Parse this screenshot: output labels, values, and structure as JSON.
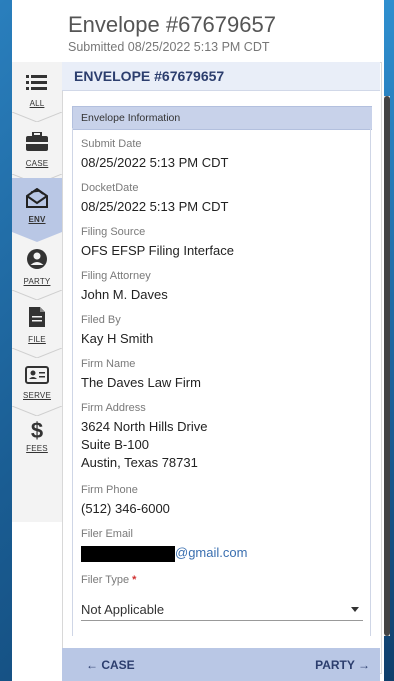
{
  "header": {
    "title": "Envelope #67679657",
    "subtitle": "Submitted 08/25/2022 5:13 PM CDT"
  },
  "sidebar": {
    "items": [
      {
        "label": "ALL",
        "icon": "list-icon"
      },
      {
        "label": "CASE",
        "icon": "briefcase-icon"
      },
      {
        "label": "ENV",
        "icon": "envelope-icon",
        "active": true
      },
      {
        "label": "PARTY",
        "icon": "person-icon"
      },
      {
        "label": "FILE",
        "icon": "document-icon"
      },
      {
        "label": "SERVE",
        "icon": "id-card-icon"
      },
      {
        "label": "FEES",
        "icon": "dollar-icon"
      }
    ]
  },
  "panel": {
    "title": "ENVELOPE #67679657",
    "section_title": "Envelope Information",
    "fields": {
      "submit_date_label": "Submit Date",
      "submit_date": "08/25/2022 5:13 PM CDT",
      "docket_date_label": "DocketDate",
      "docket_date": "08/25/2022 5:13 PM CDT",
      "filing_source_label": "Filing Source",
      "filing_source": "OFS EFSP Filing Interface",
      "filing_attorney_label": "Filing Attorney",
      "filing_attorney": "John M. Daves",
      "filed_by_label": "Filed By",
      "filed_by": "Kay H Smith",
      "firm_name_label": "Firm Name",
      "firm_name": "The Daves Law Firm",
      "firm_address_label": "Firm Address",
      "firm_address_line1": "3624 North Hills Drive",
      "firm_address_line2": "Suite B-100",
      "firm_address_line3": "Austin, Texas 78731",
      "firm_phone_label": "Firm Phone",
      "firm_phone": "(512) 346-6000",
      "filer_email_label": "Filer Email",
      "filer_email_domain": "@gmail.com",
      "filer_type_label": "Filer Type",
      "filer_type_required": "*",
      "filer_type": "Not Applicable"
    }
  },
  "footer": {
    "prev_label": "← CASE",
    "next_label": "PARTY →"
  },
  "colors": {
    "accent": "#2c3e6e",
    "active_tab": "#b9c7e5",
    "section_header": "#c8d2ea",
    "link": "#3a6fb0",
    "required": "#d03030"
  }
}
